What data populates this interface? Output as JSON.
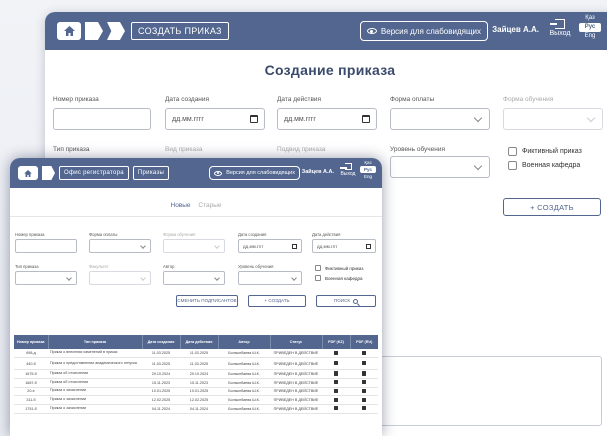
{
  "back": {
    "crumb_title": "СОЗДАТЬ ПРИКАЗ",
    "vision_label": "Версия для слабовидящих",
    "user": "Зайцев А.А.",
    "logout": "Выход",
    "langs": [
      "Қаз",
      "Рус",
      "Eng"
    ],
    "page_title": "Создание приказа",
    "labels": {
      "order_number": "Номер приказа",
      "created_date": "Дата создания",
      "action_date": "Дата действия",
      "payment_form": "Форма оплаты",
      "study_form": "Форма обучения",
      "order_type": "Тип приказа",
      "order_kind": "Вид приказа",
      "order_subtype": "Подвид приказа",
      "study_level": "Уровень обучения"
    },
    "date_placeholder": "дд.мм.гггг",
    "fictive": "Фиктивный приказ",
    "military": "Военная кафедра",
    "create_btn": "+ СОЗДАТЬ"
  },
  "front": {
    "crumb1": "Офис регистратора",
    "crumb2": "Приказы",
    "vision_label": "Версия для слабовидящих",
    "user": "Зайцев А.А.",
    "logout": "Выход",
    "langs": [
      "Қаз",
      "Рус",
      "Eng"
    ],
    "tab_new": "Новые",
    "tab_old": "Старые",
    "labels": {
      "order_number": "Номер приказа",
      "payment_form": "Форма оплаты",
      "study_form": "Форма обучения",
      "created_date": "Дата создания",
      "action_date": "Дата действия",
      "order_type": "Тип приказа",
      "faculty": "Факультет",
      "author": "Автор",
      "study_level": "Уровень обучения"
    },
    "date_placeholder": "дд.мм.гггг",
    "fictive": "Фиктивный приказ",
    "military": "Военная кафедра",
    "change_signers_btn": "СМЕНИТЬ ПОДПИСАНТОВ",
    "create_btn": "+ СОЗДАТЬ",
    "search_btn": "ПОИСК",
    "columns": [
      "Номер приказа",
      "Тип приказа",
      "Дата создания",
      "Дата действия",
      "Автор",
      "Статус",
      "PDF (KZ)",
      "PDF (RU)"
    ],
    "rows": [
      {
        "num": "698-д",
        "type": "Приказ о внесении изменений в приказ",
        "created": "11.03.2025",
        "action": "11.03.2025",
        "author": "Болзынбаева Ш.К.",
        "status": "ПРИВЕДЕН В ДЕЙСТВИЕ"
      },
      {
        "num": "440-б",
        "type": "Приказ о предоставлении академического отпуска",
        "created": "11.03.2025",
        "action": "11.03.2025",
        "author": "Болзынбаева Ш.К.",
        "status": "ПРИВЕДЕН В ДЕЙСТВИЕ"
      },
      {
        "num": "1675-б",
        "type": "Приказ об отчислении",
        "created": "29.10.2024",
        "action": "29.10.2024",
        "author": "Болзынбаева Ш.К.",
        "status": "ПРИВЕДЕН В ДЕЙСТВИЕ"
      },
      {
        "num": "1687-б",
        "type": "Приказ об отчислении",
        "created": "15.11.2023",
        "action": "15.11.2023",
        "author": "Болзынбаева Ш.К.",
        "status": "ПРИВЕДЕН В ДЕЙСТВИЕ"
      },
      {
        "num": "20-е",
        "type": "Приказ о зачислении",
        "created": "10.01.2025",
        "action": "10.01.2025",
        "author": "Болзынбаева Ш.К.",
        "status": "ПРИВЕДЕН В ДЕЙСТВИЕ"
      },
      {
        "num": "311-б",
        "type": "Приказ о зачислении",
        "created": "12.02.2025",
        "action": "12.02.2025",
        "author": "Болзынбаева Ш.К.",
        "status": "ПРИВЕДЕН В ДЕЙСТВИЕ"
      },
      {
        "num": "1751-б",
        "type": "Приказ о зачислении",
        "created": "04.11.2024",
        "action": "04.11.2024",
        "author": "Болзынбаева Ш.К.",
        "status": "ПРИВЕДЕН В ДЕЙСТВИЕ"
      }
    ]
  }
}
